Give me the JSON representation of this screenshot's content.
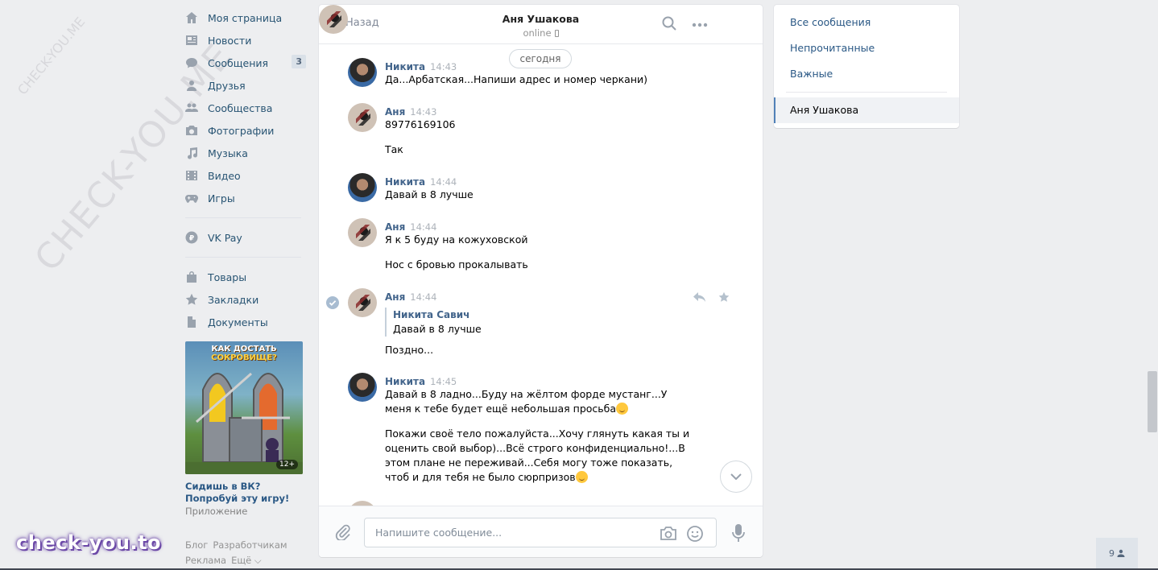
{
  "watermarks": {
    "diagonal_big": "CHECK-YOU.ME",
    "diagonal_small": "CHECK-YOU.ME",
    "brand": "check-you.to"
  },
  "nav": {
    "items": [
      {
        "label": "Моя страница",
        "icon": "home-icon"
      },
      {
        "label": "Новости",
        "icon": "news-icon"
      },
      {
        "label": "Сообщения",
        "icon": "messages-icon",
        "count": "3"
      },
      {
        "label": "Друзья",
        "icon": "friends-icon"
      },
      {
        "label": "Сообщества",
        "icon": "communities-icon"
      },
      {
        "label": "Фотографии",
        "icon": "camera-icon"
      },
      {
        "label": "Музыка",
        "icon": "music-icon"
      },
      {
        "label": "Видео",
        "icon": "video-icon"
      },
      {
        "label": "Игры",
        "icon": "gamepad-icon"
      }
    ],
    "vkpay": {
      "label": "VK Pay",
      "icon": "vkpay-icon"
    },
    "extra": [
      {
        "label": "Товары",
        "icon": "bag-icon"
      },
      {
        "label": "Закладки",
        "icon": "star-icon"
      },
      {
        "label": "Документы",
        "icon": "document-icon"
      }
    ]
  },
  "ad": {
    "banner_text_white": "КАК ДОСТАТЬ",
    "banner_text_yellow": "СОКРОВИЩЕ?",
    "age": "12+",
    "caption": "Сидишь в ВК? Попробуй эту игру!",
    "subtitle": "Приложение"
  },
  "footer": {
    "links": [
      "Блог",
      "Разработчикам",
      "Реклама",
      "Ещё ⌵"
    ]
  },
  "chat": {
    "back_label": "Назад",
    "peer_name": "Аня Ушакова",
    "peer_status": "online",
    "date_label": "сегодня",
    "input_placeholder": "Напишите сообщение...",
    "messages": [
      {
        "author": "Никита",
        "time": "14:43",
        "texts": [
          "Да...Арбатская...Напиши адрес и номер черкани)"
        ]
      },
      {
        "author": "Аня",
        "time": "14:43",
        "texts": [
          "89776169106",
          "Так"
        ]
      },
      {
        "author": "Никита",
        "time": "14:44",
        "texts": [
          "Давай в 8 лучше"
        ]
      },
      {
        "author": "Аня",
        "time": "14:44",
        "texts": [
          "Я к 5 буду на кожуховской",
          "Нос с бровью прокалывать"
        ]
      },
      {
        "author": "Аня",
        "time": "14:44",
        "reply_author": "Никита Савич",
        "reply_text": "Давай в 8 лучше",
        "texts": [
          "Поздно..."
        ]
      },
      {
        "author": "Никита",
        "time": "14:45",
        "texts": [
          "Давай в 8 ладно...Буду на жёлтом форде мустанг...У меня к тебе будет ещё небольшая просьба",
          "Покажи своё тело пожалуйста...Хочу глянуть какая ты и оценить свой выбор)...Всё строго конфиденциально!...В этом плане не переживай...Себя могу тоже показать, чтоб и для тебя не было сюрпризов"
        ]
      }
    ]
  },
  "filters": {
    "items": [
      "Все сообщения",
      "Непрочитанные",
      "Важные"
    ],
    "active": "Аня Ушакова"
  },
  "friends_online_count": "9",
  "colors": {
    "link": "#2a5885",
    "author": "#42648b",
    "bg": "#edeef0",
    "accent": "#5181b8"
  }
}
